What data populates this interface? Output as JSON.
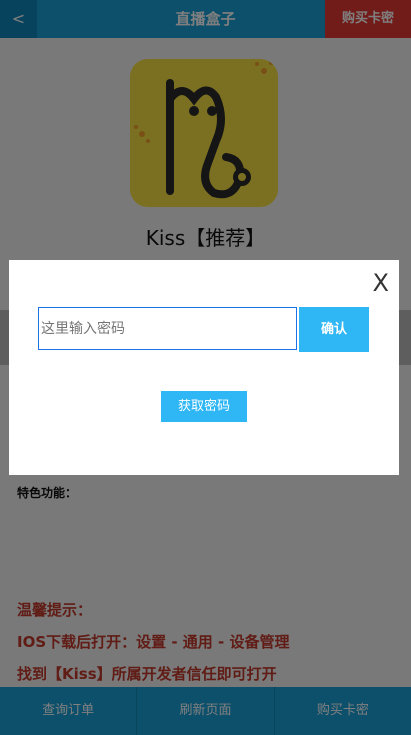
{
  "header": {
    "back_label": "<",
    "title": "直播盒子",
    "buy_label": "购买卡密"
  },
  "app": {
    "name": "Kiss【推荐】",
    "icon": "kiss-app-icon"
  },
  "features_label": "特色功能：",
  "tips": {
    "title": "温馨提示：",
    "line1": "IOS下载后打开：设置 - 通用 - 设备管理",
    "line2": "找到【Kiss】所属开发者信任即可打开"
  },
  "bottom_nav": {
    "query_order": "查询订单",
    "refresh": "刷新页面",
    "buy": "购买卡密"
  },
  "modal": {
    "close_label": "X",
    "password_placeholder": "这里输入密码",
    "password_value": "",
    "confirm_label": "确认",
    "get_password_label": "获取密码"
  },
  "colors": {
    "primary": "#1aa0d6",
    "accent": "#e53935",
    "button": "#2fb7f5",
    "tip_text": "#c0392b"
  }
}
